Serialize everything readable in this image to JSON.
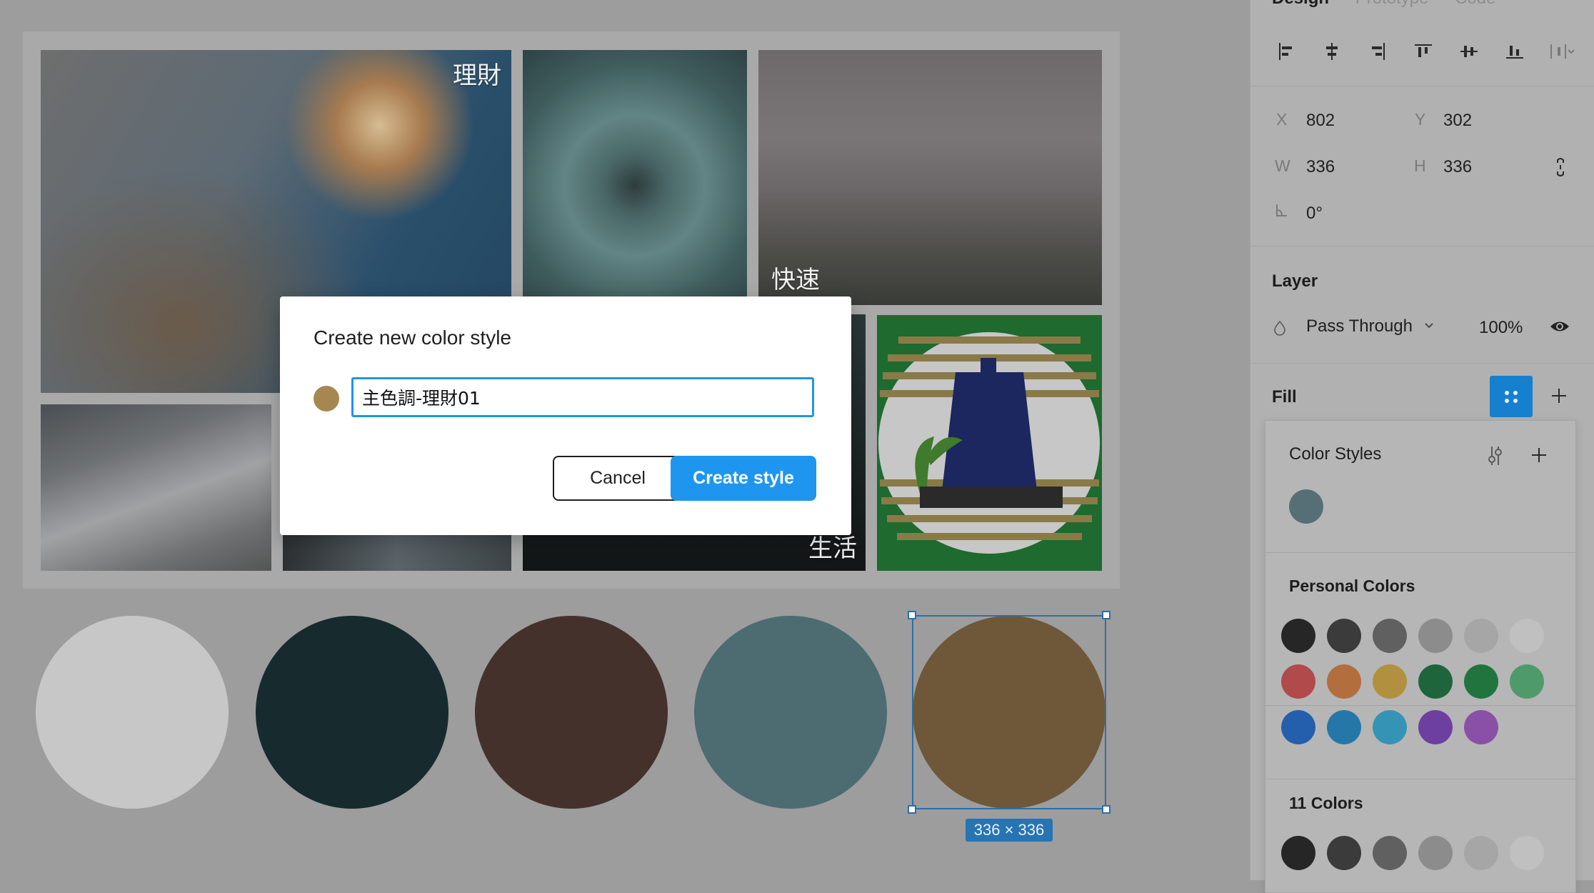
{
  "board": {
    "captions": {
      "finance": "理財",
      "fast": "快速",
      "life": "生活"
    }
  },
  "swatches": [
    {
      "name": "light-gray",
      "color": "#c7c7c7"
    },
    {
      "name": "dark-teal",
      "color": "#172b2e"
    },
    {
      "name": "dark-brown",
      "color": "#45312b"
    },
    {
      "name": "slate-teal",
      "color": "#4c6c71"
    },
    {
      "name": "bronze",
      "color": "#6e5839"
    }
  ],
  "selection": {
    "size_label": "336 × 336"
  },
  "panel": {
    "tabs": [
      "Design",
      "Prototype",
      "Code"
    ],
    "x_label": "X",
    "x_value": "802",
    "y_label": "Y",
    "y_value": "302",
    "w_label": "W",
    "w_value": "336",
    "h_label": "H",
    "h_value": "336",
    "rotation_value": "0°",
    "layer_title": "Layer",
    "blend_mode": "Pass Through",
    "opacity": "100%",
    "fill_title": "Fill"
  },
  "color_styles": {
    "title": "Color Styles",
    "styles": [
      "#566f76"
    ],
    "personal_title": "Personal Colors",
    "personal_colors": [
      "#262626",
      "#3b3b3b",
      "#606060",
      "#8c8c8c",
      "#a6a6a6",
      "#c0c0c0",
      "#b14a4a",
      "#b26e3d",
      "#b1913f",
      "#1f653c",
      "#22743f",
      "#4e9a6b",
      "#235fac",
      "#2577a8",
      "#3594b5",
      "#6d3fa1",
      "#8a4fa7"
    ],
    "eleven_title": "11 Colors",
    "eleven_colors": [
      "#262626",
      "#3b3b3b",
      "#606060",
      "#8c8c8c",
      "#a6a6a6",
      "#c0c0c0"
    ]
  },
  "modal": {
    "title": "Create new color style",
    "swatch_color": "#a68751",
    "input_value": "主色調-理財01",
    "cancel_label": "Cancel",
    "create_label": "Create style"
  }
}
